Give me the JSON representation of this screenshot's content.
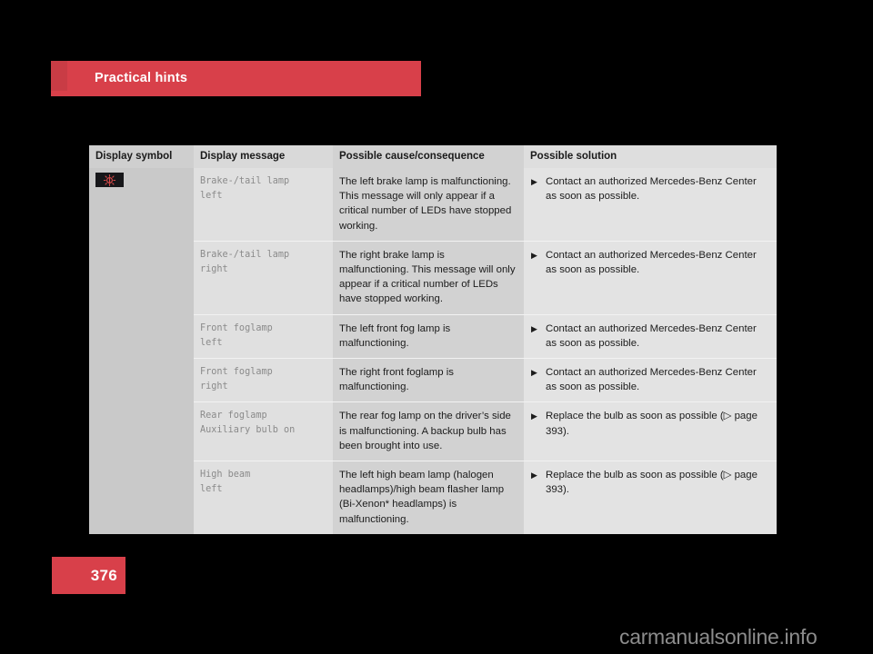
{
  "section": {
    "title": "Practical hints"
  },
  "page": {
    "number": "376",
    "watermark": "carmanualsonline.info"
  },
  "colors": {
    "accent_red": "#d8404a",
    "banner_notch_red": "#c93c45",
    "symbol_tile_bg": "#17171a",
    "symbol_glyph": "#d94a4a",
    "table_bg": "#e3e3e3",
    "col_symbol_bg": "#c9c9c9",
    "col_message_bg": "#e0e0e0",
    "col_cause_bg": "#d2d2d2",
    "col_solution_bg": "#e3e3e3",
    "header_text": "#1a1a1a",
    "message_text": "#8a8a8a",
    "body_text": "#1c1c1c"
  },
  "table": {
    "headers": [
      "Display symbol",
      "Display message",
      "Possible cause/consequence",
      "Possible solution"
    ],
    "rows": [
      {
        "symbol": "lamp-malfunction-icon",
        "has_symbol": true,
        "message": "Brake-/tail lamp\nleft",
        "cause": "The left brake lamp is malfunctioning. This message will only appear if a critical number of LEDs have stopped working.",
        "bullet": "▶",
        "solution": "Contact an authorized Mercedes-Benz Center as soon as possible."
      },
      {
        "symbol": "",
        "has_symbol": false,
        "message": "Brake-/tail lamp\nright",
        "cause": "The right brake lamp is malfunctioning. This message will only appear if a critical number of LEDs have stopped working.",
        "bullet": "▶",
        "solution": "Contact an authorized Mercedes-Benz Center as soon as possible."
      },
      {
        "symbol": "",
        "has_symbol": false,
        "message": "Front foglamp\nleft",
        "cause": "The left front fog lamp is malfunctioning.",
        "bullet": "▶",
        "solution": "Contact an authorized Mercedes-Benz Center as soon as possible."
      },
      {
        "symbol": "",
        "has_symbol": false,
        "message": "Front foglamp\nright",
        "cause": "The right front foglamp is malfunctioning.",
        "bullet": "▶",
        "solution": "Contact an authorized Mercedes-Benz Center as soon as possible."
      },
      {
        "symbol": "",
        "has_symbol": false,
        "message": "Rear foglamp\nAuxiliary bulb on",
        "cause": "The rear fog lamp on the driver’s side is malfunctioning. A backup bulb has been brought into use.",
        "bullet": "▶",
        "solution": "Replace the bulb as soon as possible (▷ page 393)."
      },
      {
        "symbol": "",
        "has_symbol": false,
        "message": "High beam\nleft",
        "cause": "The left high beam lamp (halogen headlamps)/high beam flasher lamp (Bi-Xenon* headlamps) is malfunctioning.",
        "bullet": "▶",
        "solution": "Replace the bulb as soon as possible (▷ page 393)."
      }
    ]
  }
}
